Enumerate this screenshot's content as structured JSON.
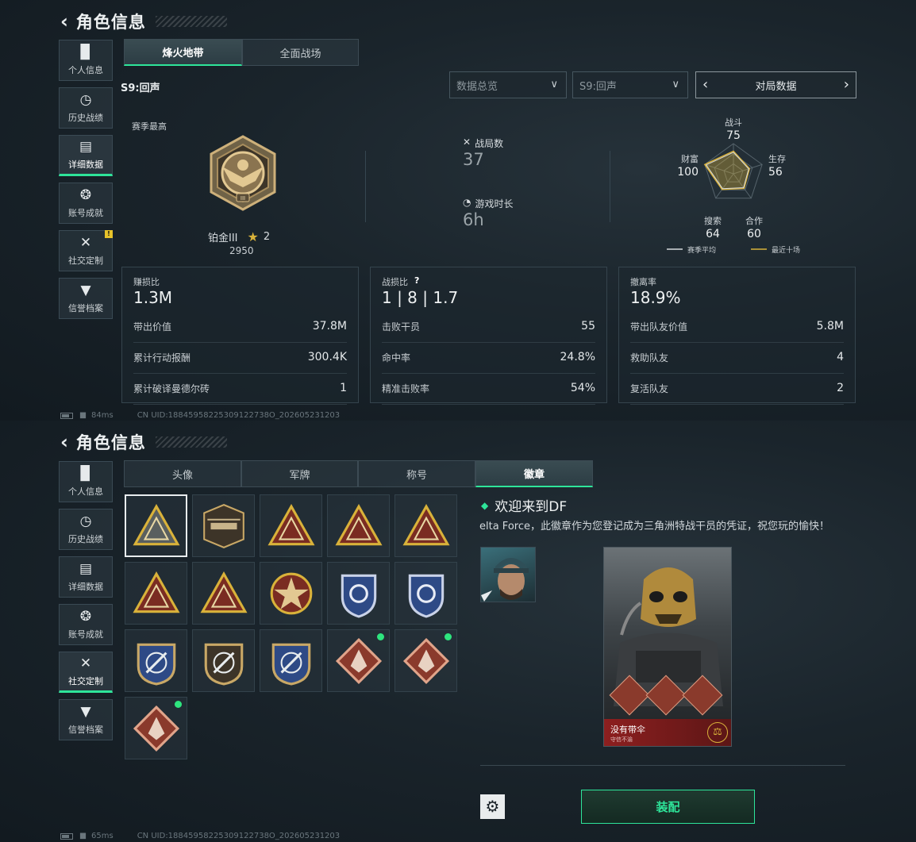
{
  "header": {
    "back_icon": "‹",
    "title": "角色信息"
  },
  "nav": [
    {
      "label": "个人信息",
      "icon": "bar-chart-icon"
    },
    {
      "label": "历史战绩",
      "icon": "clock-icon"
    },
    {
      "label": "详细数据",
      "icon": "folders-icon"
    },
    {
      "label": "账号成就",
      "icon": "achievement-icon"
    },
    {
      "label": "社交定制",
      "icon": "tools-icon",
      "badge": "!"
    },
    {
      "label": "信誉档案",
      "icon": "shield-chevron-icon"
    }
  ],
  "stats": {
    "tabs": [
      "烽火地带",
      "全面战场"
    ],
    "season_label": "S9:回声",
    "dropdowns": {
      "overview": "数据总览",
      "season": "S9:回声"
    },
    "pager": {
      "prev": "‹",
      "label": "对局数据",
      "next": "›"
    },
    "rank": {
      "caption": "赛季最高",
      "name": "铂金III",
      "stars": "2",
      "points": "2950"
    },
    "matches": {
      "label": "战局数",
      "value": "37"
    },
    "playtime": {
      "label": "游戏时长",
      "value": "6h"
    },
    "radar": {
      "axes": [
        {
          "label": "战斗",
          "value": "75"
        },
        {
          "label": "生存",
          "value": "56"
        },
        {
          "label": "合作",
          "value": "60"
        },
        {
          "label": "搜索",
          "value": "64"
        },
        {
          "label": "财富",
          "value": "100"
        }
      ],
      "legend": [
        {
          "label": "赛季平均",
          "color": "#d6dadd"
        },
        {
          "label": "最近十场",
          "color": "#d9b23a"
        }
      ]
    },
    "cards": [
      {
        "title": "赚损比",
        "value": "1.3M",
        "rows": [
          {
            "label": "带出价值",
            "value": "37.8M"
          },
          {
            "label": "累计行动报酬",
            "value": "300.4K"
          },
          {
            "label": "累计破译曼德尔砖",
            "value": "1"
          }
        ]
      },
      {
        "title": "战损比",
        "help": "?",
        "value": "1 | 8 | 1.7",
        "rows": [
          {
            "label": "击败干员",
            "value": "55"
          },
          {
            "label": "命中率",
            "value": "24.8%"
          },
          {
            "label": "精准击败率",
            "value": "54%"
          }
        ]
      },
      {
        "title": "撤离率",
        "value": "18.9%",
        "rows": [
          {
            "label": "带出队友价值",
            "value": "5.8M"
          },
          {
            "label": "救助队友",
            "value": "4"
          },
          {
            "label": "复活队友",
            "value": "2"
          }
        ]
      }
    ],
    "footer": {
      "ping": "84ms",
      "uid": "CN UID:18845958225309122738O_202605231203"
    }
  },
  "custom": {
    "tabs": [
      "头像",
      "军牌",
      "称号",
      "徽章"
    ],
    "badge_title": "欢迎来到DF",
    "badge_desc": "elta Force，此徽章作为您登记成为三角洲特战干员的凭证，祝您玩的愉快！",
    "card_name": "没有带伞",
    "card_sub": "守信不渝",
    "equip": "装配",
    "footer": {
      "ping": "65ms",
      "uid": "CN UID:18845958225309122738O_202605231203"
    }
  },
  "colors": {
    "accent": "#2ee59a",
    "gold": "#d9b23a",
    "badge_red": "#8a3a2c",
    "badge_blue": "#2e4a86"
  }
}
